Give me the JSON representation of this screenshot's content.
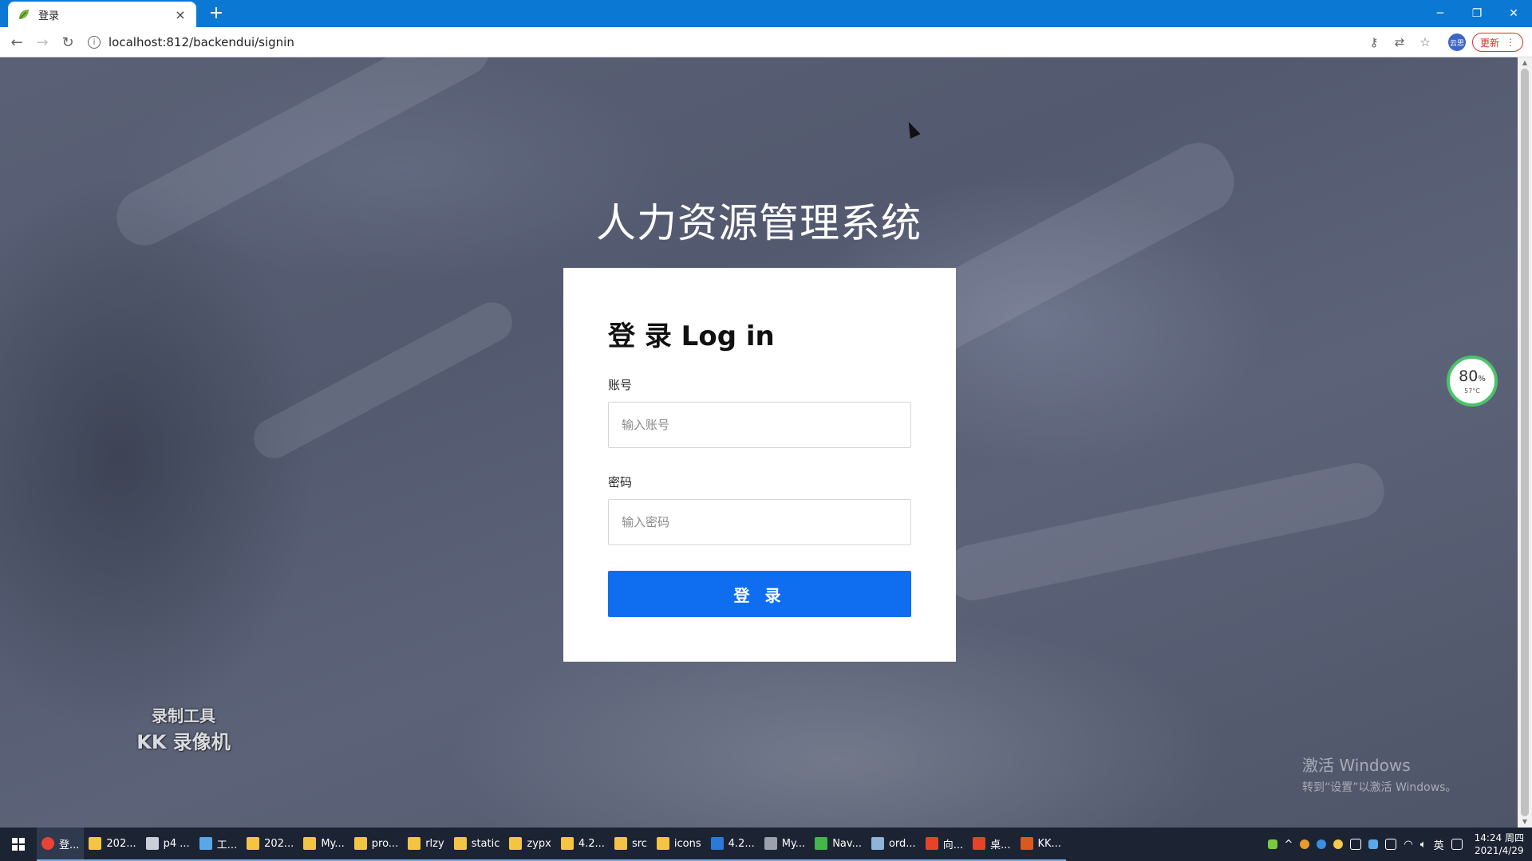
{
  "browser": {
    "tab_title": "登录",
    "new_tab": "+",
    "url": "localhost:812/backendui/signin",
    "update_label": "更新",
    "profile_label": "云思",
    "window_minimize": "─",
    "window_restore": "❐",
    "window_close": "✕"
  },
  "page": {
    "system_title": "人力资源管理系统",
    "login_heading": "登 录 Log in",
    "account_label": "账号",
    "account_placeholder": "输入账号",
    "account_value": "",
    "password_label": "密码",
    "password_placeholder": "输入密码",
    "password_value": "",
    "submit_label": "登 录"
  },
  "overlays": {
    "record_tool_line1": "录制工具",
    "record_tool_line2": "KK 录像机",
    "activate_line1": "激活 Windows",
    "activate_line2": "转到“设置”以激活 Windows。",
    "gauge_percent": "80",
    "gauge_percent_unit": "%",
    "gauge_temp": "57°C"
  },
  "taskbar": {
    "items": [
      {
        "label": "登...",
        "icon": "chrome-icon",
        "color": "#ea4335"
      },
      {
        "label": "202...",
        "icon": "folder-icon",
        "color": "#f4c542"
      },
      {
        "label": "p4 ...",
        "icon": "app-icon",
        "color": "#c9ced8"
      },
      {
        "label": "工...",
        "icon": "app-icon",
        "color": "#5aa9e6"
      },
      {
        "label": "202...",
        "icon": "folder-icon",
        "color": "#f4c542"
      },
      {
        "label": "My...",
        "icon": "folder-icon",
        "color": "#f4c542"
      },
      {
        "label": "pro...",
        "icon": "folder-icon",
        "color": "#f4c542"
      },
      {
        "label": "rlzy",
        "icon": "folder-icon",
        "color": "#f4c542"
      },
      {
        "label": "static",
        "icon": "folder-icon",
        "color": "#f4c542"
      },
      {
        "label": "zypx",
        "icon": "folder-icon",
        "color": "#f4c542"
      },
      {
        "label": "4.2...",
        "icon": "folder-icon",
        "color": "#f4c542"
      },
      {
        "label": "src",
        "icon": "folder-icon",
        "color": "#f4c542"
      },
      {
        "label": "icons",
        "icon": "folder-icon",
        "color": "#f4c542"
      },
      {
        "label": "4.2...",
        "icon": "vscode-icon",
        "color": "#2b7bd6"
      },
      {
        "label": "My...",
        "icon": "pen-icon",
        "color": "#9aa0ac"
      },
      {
        "label": "Nav...",
        "icon": "navicat-icon",
        "color": "#44b64c"
      },
      {
        "label": "ord...",
        "icon": "app-icon",
        "color": "#8fb3d9"
      },
      {
        "label": "向...",
        "icon": "app-icon",
        "color": "#e6432b"
      },
      {
        "label": "桌...",
        "icon": "app-icon",
        "color": "#e6432b"
      },
      {
        "label": "KK...",
        "icon": "kk-recorder-icon",
        "color": "#d85a1d"
      }
    ],
    "ime": "英",
    "time": "14:24 周四",
    "date": "2021/4/29"
  }
}
